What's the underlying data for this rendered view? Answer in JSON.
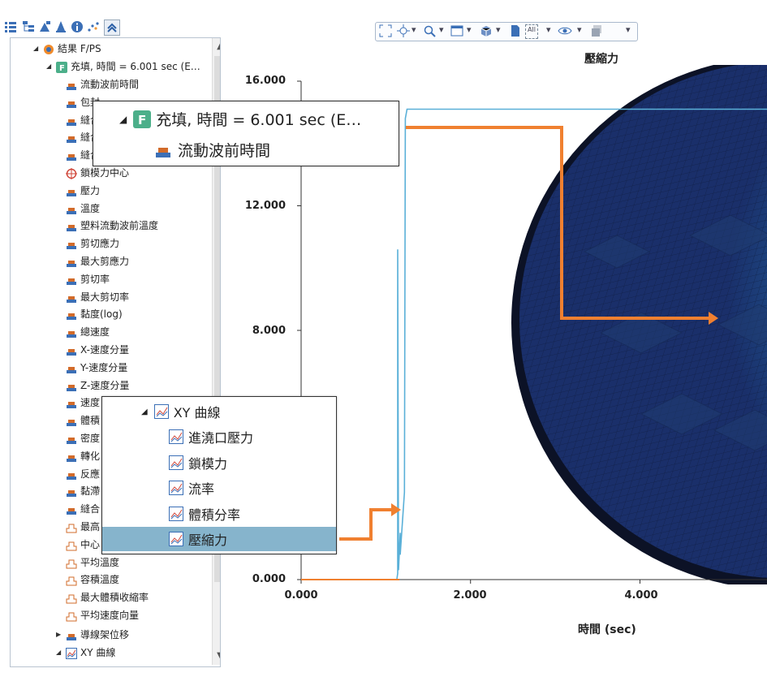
{
  "toolbar": {
    "icons": [
      "tree-list-icon",
      "hierarchy-icon",
      "mesh-icon",
      "cone-icon",
      "info-icon",
      "scatter-icon",
      "collapse-icon"
    ]
  },
  "tree": {
    "root_label": "結果  F/PS",
    "fill_node": "充填, 時間 = 6.001 sec (E…",
    "items": [
      "流動波前時間",
      "包封",
      "縫合線",
      "縫合線",
      "縫合線",
      "鎖模力中心",
      "壓力",
      "溫度",
      "塑料流動波前溫度",
      "剪切應力",
      "最大剪應力",
      "剪切率",
      "最大剪切率",
      "黏度(log)",
      "總速度",
      "X-速度分量",
      "Y-速度分量",
      "Z-速度分量",
      "速度",
      "體積",
      "密度",
      "轉化",
      "反應",
      "黏滯",
      "縫合",
      "最高",
      "中心",
      "平均溫度",
      "容積溫度",
      "最大體積收縮率",
      "平均速度向量"
    ],
    "guide_node": "導線架位移",
    "xy_node": "XY 曲線"
  },
  "zoom_top": {
    "fill_label": "充填, 時間 = 6.001 sec (E…",
    "child_label": "流動波前時間"
  },
  "zoom_bottom": {
    "xy_label": "XY 曲線",
    "items": [
      "進澆口壓力",
      "鎖模力",
      "流率",
      "體積分率",
      "壓縮力"
    ],
    "selected_index": 4
  },
  "plot": {
    "title": "壓縮力",
    "xlabel": "時間 (sec)",
    "toolbar_badge": "All",
    "colors": {
      "line": "#5ab0d8",
      "arrow": "#f08030",
      "selected": "#86b4cc"
    }
  },
  "chart_data": {
    "type": "line",
    "title": "壓縮力",
    "xlabel": "時間 (sec)",
    "ylabel": "",
    "x_ticks": [
      "0.000",
      "2.000",
      "4.000"
    ],
    "y_ticks": [
      "0.000",
      "8.000",
      "12.000",
      "16.000"
    ],
    "xlim": [
      0,
      5.5
    ],
    "ylim": [
      0,
      16
    ],
    "series": [
      {
        "x": [
          0,
          1.13,
          1.14,
          1.14,
          1.15,
          1.17,
          1.17,
          1.22,
          1.23,
          1.25,
          5.5
        ],
        "y": [
          0,
          0,
          0.2,
          10.6,
          0.3,
          1.5,
          0.8,
          2.8,
          14.8,
          15.1,
          15.1
        ]
      }
    ]
  }
}
